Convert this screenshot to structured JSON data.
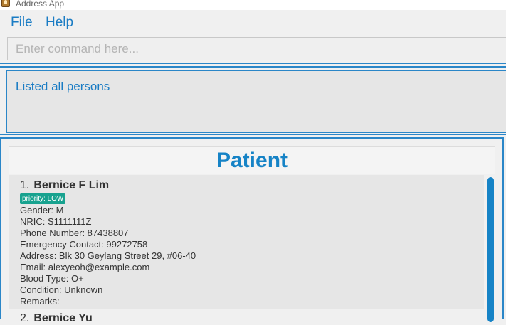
{
  "window": {
    "title": "Address App",
    "icon": "app-icon"
  },
  "menu": {
    "items": [
      {
        "label": "File"
      },
      {
        "label": "Help"
      }
    ]
  },
  "command": {
    "placeholder": "Enter command here...",
    "value": ""
  },
  "result": {
    "text": "Listed all persons"
  },
  "list": {
    "header": "Patient",
    "persons": [
      {
        "index": "1.",
        "name": "Bernice F Lim",
        "priority": "priority: LOW",
        "fields": [
          "Gender: M",
          "NRIC: S1111111Z",
          "Phone Number: 87438807",
          "Emergency Contact: 99272758",
          "Address: Blk 30 Geylang Street 29, #06-40",
          "Email: alexyeoh@example.com",
          "Blood Type: O+",
          "Condition: Unknown",
          "Remarks:"
        ]
      },
      {
        "index": "2.",
        "name": "Bernice Yu"
      }
    ]
  },
  "colors": {
    "accent": "#1683c6",
    "priority_low": "#17a28f",
    "card_bg": "#e6e6e6"
  }
}
